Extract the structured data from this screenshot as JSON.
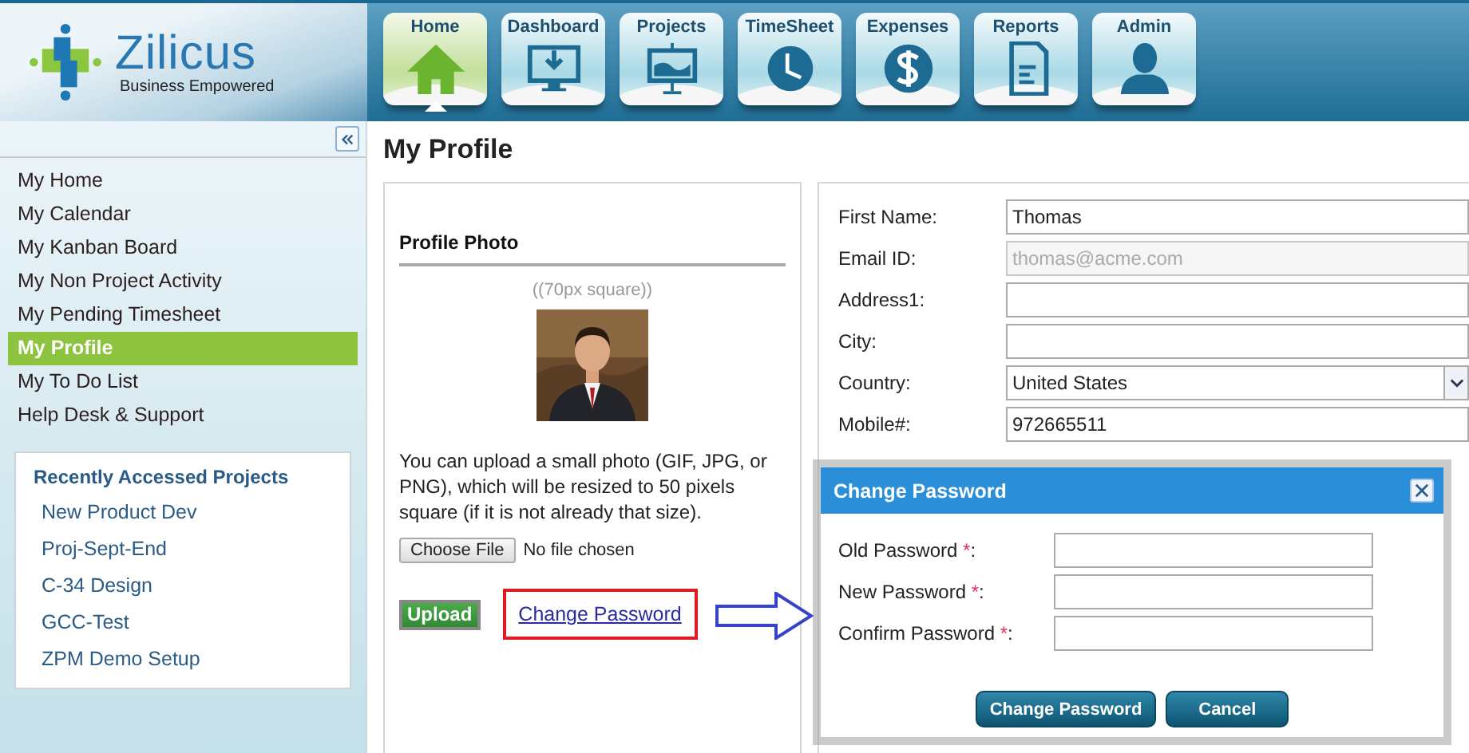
{
  "header": {
    "logo": {
      "name": "Zilicus",
      "tagline": "Business Empowered"
    }
  },
  "nav_tabs": [
    {
      "label": "Home",
      "kind": "home",
      "selected": true
    },
    {
      "label": "Dashboard",
      "kind": "monitor",
      "selected": false
    },
    {
      "label": "Projects",
      "kind": "easel",
      "selected": false
    },
    {
      "label": "TimeSheet",
      "kind": "clock",
      "selected": false
    },
    {
      "label": "Expenses",
      "kind": "dollar",
      "selected": false
    },
    {
      "label": "Reports",
      "kind": "document",
      "selected": false
    },
    {
      "label": "Admin",
      "kind": "person",
      "selected": false
    }
  ],
  "sidebar": {
    "items": [
      {
        "label": "My Home",
        "selected": false
      },
      {
        "label": "My Calendar",
        "selected": false
      },
      {
        "label": "My Kanban Board",
        "selected": false
      },
      {
        "label": "My Non Project Activity",
        "selected": false
      },
      {
        "label": "My Pending Timesheet",
        "selected": false
      },
      {
        "label": "My Profile",
        "selected": true
      },
      {
        "label": "My To Do List",
        "selected": false
      },
      {
        "label": "Help Desk & Support",
        "selected": false
      }
    ],
    "recent_projects": {
      "title": "Recently Accessed Projects",
      "items": [
        "New Product Dev",
        "Proj-Sept-End",
        "C-34 Design",
        "GCC-Test",
        "ZPM Demo Setup"
      ]
    }
  },
  "page_title": "My Profile",
  "profile_photo": {
    "title": "Profile Photo",
    "size_hint": "((70px square))",
    "description": "You can upload a small photo (GIF, JPG, or PNG), which will be resized to 50 pixels square (if it is not already that size).",
    "file_button": "Choose File",
    "file_status": "No file chosen",
    "upload_button": "Upload",
    "change_password_link": "Change Password"
  },
  "profile_form": {
    "fields": [
      {
        "label": "First Name:",
        "kind": "text",
        "value": "Thomas",
        "disabled": false
      },
      {
        "label": "Email ID:",
        "kind": "text",
        "value": "thomas@acme.com",
        "disabled": true
      },
      {
        "label": "Address1:",
        "kind": "text",
        "disabled": false
      },
      {
        "label": "City:",
        "kind": "text",
        "disabled": false
      },
      {
        "label": "Country:",
        "kind": "select",
        "value": "United States",
        "disabled": false
      },
      {
        "label": "Mobile#:",
        "kind": "text",
        "value": "972665511",
        "disabled": false
      }
    ]
  },
  "dialog": {
    "title": "Change Password",
    "fields": [
      {
        "label": "Old Password",
        "required_mark": "*",
        "label_end": ":"
      },
      {
        "label": "New Password",
        "required_mark": "*",
        "label_end": ":"
      },
      {
        "label": "Confirm Password",
        "required_mark": "*",
        "label_end": ":"
      }
    ],
    "buttons": [
      "Change Password",
      "Cancel"
    ]
  }
}
